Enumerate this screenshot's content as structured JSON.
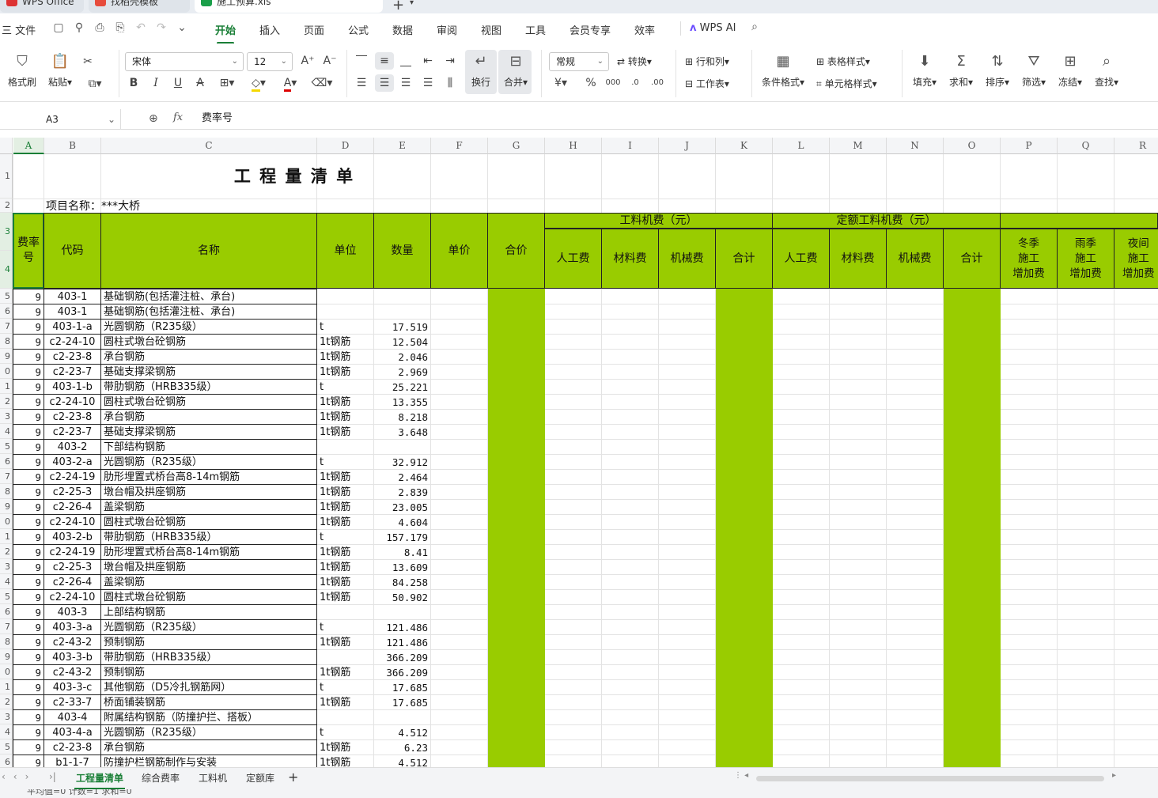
{
  "tabs": {
    "wps_office": "WPS Office",
    "template": "找稻壳模板",
    "file": "施工预算.xls",
    "new_tab": "+"
  },
  "menu": {
    "file": "三 文件",
    "items": [
      "开始",
      "插入",
      "页面",
      "公式",
      "数据",
      "审阅",
      "视图",
      "工具",
      "会员专享",
      "效率"
    ],
    "active": "开始",
    "wps_ai": "WPS AI"
  },
  "ribbon": {
    "format_painter": "格式刷",
    "paste": "粘贴",
    "font_name": "宋体",
    "font_size": "12",
    "wrap": "换行",
    "merge": "合并",
    "number_format": "常规",
    "convert": "转换",
    "row_col": "行和列",
    "worksheet": "工作表",
    "cond_format": "条件格式",
    "table_style": "表格样式",
    "cell_style": "单元格样式",
    "fill": "填充",
    "sum": "求和",
    "sort": "排序",
    "filter": "筛选",
    "freeze": "冻结",
    "find": "查找",
    "bold": "B",
    "italic": "I",
    "underline": "U",
    "percent": "%"
  },
  "formula_bar": {
    "cell_ref": "A3",
    "fx": "fx",
    "content": "费率号"
  },
  "columns": [
    "A",
    "B",
    "C",
    "D",
    "E",
    "F",
    "G",
    "H",
    "I",
    "J",
    "K",
    "L",
    "M",
    "N",
    "O",
    "P",
    "Q",
    "R"
  ],
  "row_numbers_top": [
    "1",
    "2",
    "3",
    "4"
  ],
  "sheet": {
    "title": "工 程 量 清 单",
    "project": "项目名称：***大桥",
    "headers": {
      "rate_no": "费率\n号",
      "code": "代码",
      "name": "名称",
      "unit": "单位",
      "qty": "数量",
      "unit_price": "单价",
      "total": "合价",
      "group1": "工料机费（元）",
      "group2": "定额工料机费（元）",
      "labor": "人工费",
      "material": "材料费",
      "machine": "机械费",
      "subtotal": "合计",
      "labor2": "人工费",
      "material2": "材料费",
      "machine2": "机械费",
      "subtotal2": "合计",
      "winter": "冬季\n施工\n增加费",
      "rain": "雨季\n施工\n增加费",
      "night": "夜间\n施工\n增加费"
    },
    "rows": [
      {
        "r": "5",
        "a": "9",
        "b": "403-1",
        "c": "基础钢筋(包括灌注桩、承台)",
        "d": "",
        "e": ""
      },
      {
        "r": "6",
        "a": "9",
        "b": "403-1",
        "c": "基础钢筋(包括灌注桩、承台)",
        "d": "",
        "e": ""
      },
      {
        "r": "7",
        "a": "9",
        "b": "403-1-a",
        "c": "光圆钢筋（R235级）",
        "d": "t",
        "e": "17.519"
      },
      {
        "r": "8",
        "a": "9",
        "b": "c2-24-10",
        "c": "圆柱式墩台砼钢筋",
        "d": "1t钢筋",
        "e": "12.504"
      },
      {
        "r": "9",
        "a": "9",
        "b": "c2-23-8",
        "c": "承台钢筋",
        "d": "1t钢筋",
        "e": "2.046"
      },
      {
        "r": "0",
        "a": "9",
        "b": "c2-23-7",
        "c": "基础支撑梁钢筋",
        "d": "1t钢筋",
        "e": "2.969"
      },
      {
        "r": "1",
        "a": "9",
        "b": "403-1-b",
        "c": "带肋钢筋（HRB335级）",
        "d": "t",
        "e": "25.221"
      },
      {
        "r": "2",
        "a": "9",
        "b": "c2-24-10",
        "c": "圆柱式墩台砼钢筋",
        "d": "1t钢筋",
        "e": "13.355"
      },
      {
        "r": "3",
        "a": "9",
        "b": "c2-23-8",
        "c": "承台钢筋",
        "d": "1t钢筋",
        "e": "8.218"
      },
      {
        "r": "4",
        "a": "9",
        "b": "c2-23-7",
        "c": "基础支撑梁钢筋",
        "d": "1t钢筋",
        "e": "3.648"
      },
      {
        "r": "5",
        "a": "9",
        "b": "403-2",
        "c": "下部结构钢筋",
        "d": "",
        "e": ""
      },
      {
        "r": "6",
        "a": "9",
        "b": "403-2-a",
        "c": "光圆钢筋（R235级）",
        "d": "t",
        "e": "32.912"
      },
      {
        "r": "7",
        "a": "9",
        "b": "c2-24-19",
        "c": "肋形埋置式桥台高8-14m钢筋",
        "d": "1t钢筋",
        "e": "2.464"
      },
      {
        "r": "8",
        "a": "9",
        "b": "c2-25-3",
        "c": "墩台帽及拱座钢筋",
        "d": "1t钢筋",
        "e": "2.839"
      },
      {
        "r": "9",
        "a": "9",
        "b": "c2-26-4",
        "c": "盖梁钢筋",
        "d": "1t钢筋",
        "e": "23.005"
      },
      {
        "r": "0",
        "a": "9",
        "b": "c2-24-10",
        "c": "圆柱式墩台砼钢筋",
        "d": "1t钢筋",
        "e": "4.604"
      },
      {
        "r": "1",
        "a": "9",
        "b": "403-2-b",
        "c": "带肋钢筋（HRB335级）",
        "d": "t",
        "e": "157.179"
      },
      {
        "r": "2",
        "a": "9",
        "b": "c2-24-19",
        "c": "肋形埋置式桥台高8-14m钢筋",
        "d": "1t钢筋",
        "e": "8.41"
      },
      {
        "r": "3",
        "a": "9",
        "b": "c2-25-3",
        "c": "墩台帽及拱座钢筋",
        "d": "1t钢筋",
        "e": "13.609"
      },
      {
        "r": "4",
        "a": "9",
        "b": "c2-26-4",
        "c": "盖梁钢筋",
        "d": "1t钢筋",
        "e": "84.258"
      },
      {
        "r": "5",
        "a": "9",
        "b": "c2-24-10",
        "c": "圆柱式墩台砼钢筋",
        "d": "1t钢筋",
        "e": "50.902"
      },
      {
        "r": "6",
        "a": "9",
        "b": "403-3",
        "c": "上部结构钢筋",
        "d": "",
        "e": ""
      },
      {
        "r": "7",
        "a": "9",
        "b": "403-3-a",
        "c": "光圆钢筋（R235级）",
        "d": "t",
        "e": "121.486"
      },
      {
        "r": "8",
        "a": "9",
        "b": "c2-43-2",
        "c": "预制钢筋",
        "d": "1t钢筋",
        "e": "121.486"
      },
      {
        "r": "9",
        "a": "9",
        "b": "403-3-b",
        "c": "带肋钢筋（HRB335级）",
        "d": "",
        "e": "366.209"
      },
      {
        "r": "0",
        "a": "9",
        "b": "c2-43-2",
        "c": "预制钢筋",
        "d": "1t钢筋",
        "e": "366.209"
      },
      {
        "r": "1",
        "a": "9",
        "b": "403-3-c",
        "c": "其他钢筋（D5冷扎钢筋网）",
        "d": "t",
        "e": "17.685"
      },
      {
        "r": "2",
        "a": "9",
        "b": "c2-33-7",
        "c": "桥面铺装钢筋",
        "d": "1t钢筋",
        "e": "17.685"
      },
      {
        "r": "3",
        "a": "9",
        "b": "403-4",
        "c": "附属结构钢筋（防撞护拦、搭板）",
        "d": "",
        "e": ""
      },
      {
        "r": "4",
        "a": "9",
        "b": "403-4-a",
        "c": "光圆钢筋（R235级）",
        "d": "t",
        "e": "4.512"
      },
      {
        "r": "5",
        "a": "9",
        "b": "c2-23-8",
        "c": "承台钢筋",
        "d": "1t钢筋",
        "e": "6.23"
      },
      {
        "r": "6",
        "a": "9",
        "b": "b1-1-7",
        "c": "防撞护栏钢筋制作与安装",
        "d": "1t钢筋",
        "e": "4.512"
      }
    ]
  },
  "sheet_tabs": [
    "工程量清单",
    "综合费率",
    "工料机",
    "定额库"
  ],
  "sheet_tab_active": "工程量清单",
  "status": "平均值=0  计数=1  求和=0",
  "colors": {
    "accent": "#1a7f37",
    "cell_green": "#99cc00"
  }
}
